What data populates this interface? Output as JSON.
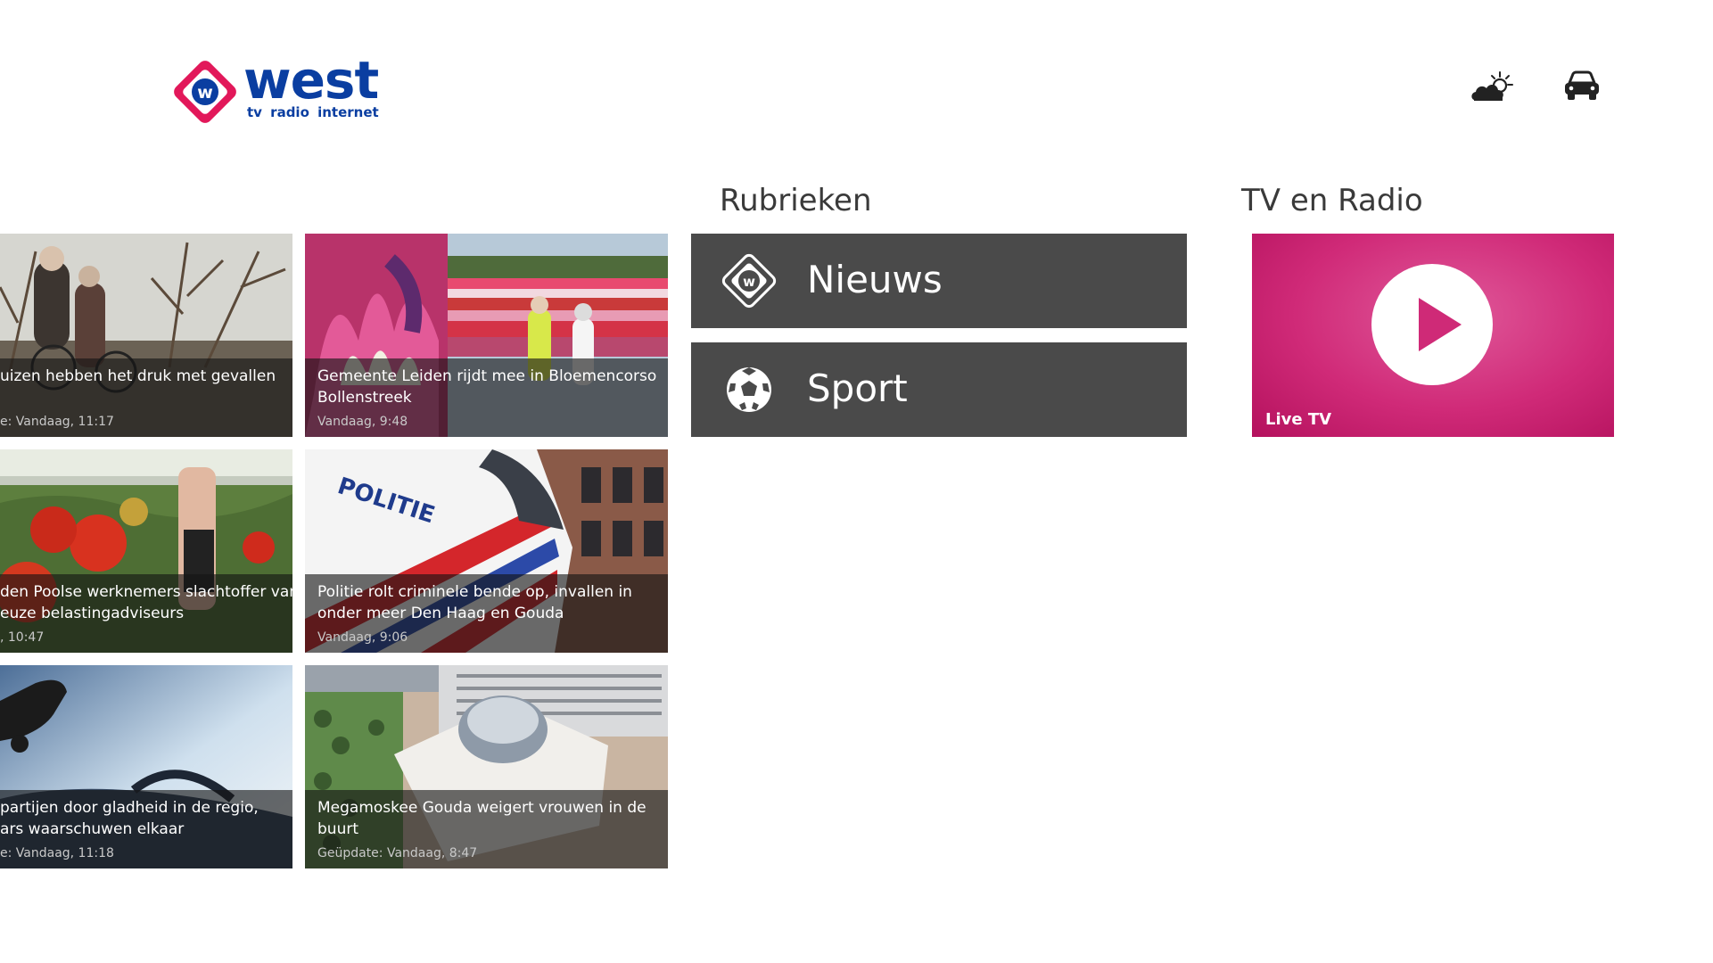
{
  "header": {
    "logo": {
      "word": "west",
      "tagline": "tv radio internet",
      "badge_letter": "w"
    },
    "icons": [
      {
        "name": "weather-icon"
      },
      {
        "name": "traffic-icon"
      }
    ]
  },
  "sections": {
    "rubrieken_title": "Rubrieken",
    "tvradio_title": "TV en Radio"
  },
  "news": [
    {
      "title_line1": "uizen hebben het druk met gevallen",
      "title_line2": "",
      "meta": "e: Vandaag, 11:17"
    },
    {
      "title_line1": "Gemeente Leiden rijdt mee in Bloemencorso",
      "title_line2": "Bollenstreek",
      "meta": "Vandaag, 9:48"
    },
    {
      "title_line1": "den Poolse werknemers slachtoffer van",
      "title_line2": "euze belastingadviseurs",
      "meta": ", 10:47"
    },
    {
      "title_line1": "Politie rolt criminele bende op, invallen in",
      "title_line2": "onder meer Den Haag en Gouda",
      "meta": "Vandaag, 9:06"
    },
    {
      "title_line1": "partijen door gladheid in de regio,",
      "title_line2": "ars waarschuwen elkaar",
      "meta": "e: Vandaag, 11:18"
    },
    {
      "title_line1": "Megamoskee Gouda weigert vrouwen in de",
      "title_line2": "buurt",
      "meta": "Geüpdate: Vandaag, 8:47"
    }
  ],
  "rubrieken": [
    {
      "label": "Nieuws",
      "icon": "west-w-icon"
    },
    {
      "label": "Sport",
      "icon": "football-icon"
    }
  ],
  "tvradio": {
    "live_label": "Live TV",
    "icon": "play-icon"
  },
  "colors": {
    "brand_blue": "#0a3ea1",
    "brand_pink": "#d02a78",
    "tile_gray": "#4a4a4a"
  }
}
